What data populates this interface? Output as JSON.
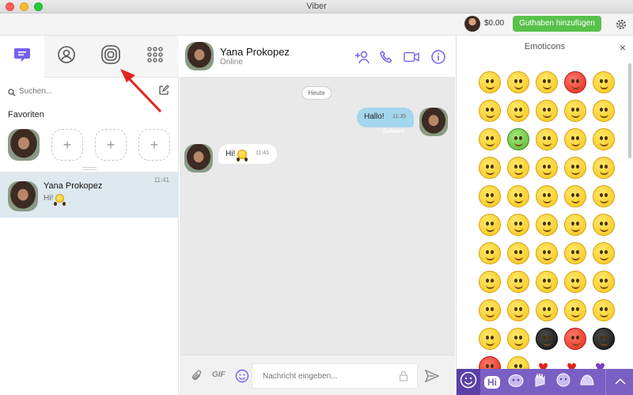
{
  "window": {
    "title": "Viber"
  },
  "topbar": {
    "balance": "$0.00",
    "add_credit_label": "Guthaben hinzufügen"
  },
  "left": {
    "search_placeholder": "Suchen...",
    "favorites_title": "Favoriten",
    "add_symbol": "+",
    "chat": {
      "name": "Yana Prokopez",
      "preview": "Hi!",
      "time": "11:41"
    }
  },
  "chat": {
    "contact_name": "Yana Prokopez",
    "status": "Online",
    "date_divider": "Heute",
    "outgoing": {
      "text": "Hallo!",
      "time": "11:35",
      "receipt": "Gelesen"
    },
    "incoming": {
      "text": "Hi!",
      "time": "11:41"
    },
    "composer": {
      "gif_label": "GIF",
      "placeholder": "Nachricht eingeben..."
    }
  },
  "emoji": {
    "title": "Emoticons",
    "close": "×",
    "items": [
      "smile",
      "neutral",
      "wink",
      "angry",
      "heart-eyes",
      "happy",
      "laugh",
      "surprised",
      "confused",
      "grin",
      "tongue",
      "sick",
      "tongue-out",
      "teeth",
      "cheeky",
      "money",
      "smirk",
      "cool-wink",
      "worried",
      "unamused",
      "sad",
      "dizzy",
      "nerd",
      "sleepy",
      "sunglasses",
      "cry-laugh",
      "rofl",
      "kiss",
      "blush",
      "big-grin",
      "spiral",
      "dead",
      "relieved",
      "bored",
      "meh",
      "vampire",
      "shock",
      "smug",
      "eye-roll",
      "frown",
      "mad",
      "squint",
      "tearful",
      "music",
      "sly",
      "pout",
      "tired",
      "ninja",
      "spider",
      "cat-mask",
      "devil",
      "angel",
      "heart",
      "broken-heart",
      "purple-heart"
    ],
    "tab_hi": "Hi"
  },
  "colors": {
    "accent": "#7360f2",
    "credit": "#58c14a",
    "bubble_out": "#a4d7ee",
    "chat_bg": "#e9e9e9"
  }
}
